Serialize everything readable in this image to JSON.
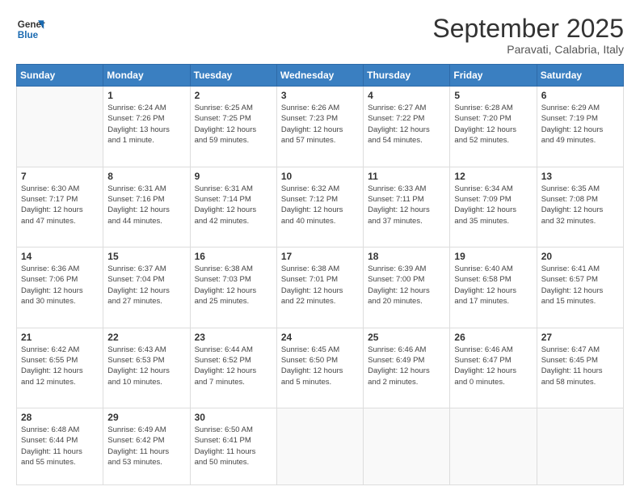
{
  "logo": {
    "text_general": "General",
    "text_blue": "Blue"
  },
  "title": "September 2025",
  "subtitle": "Paravati, Calabria, Italy",
  "header_days": [
    "Sunday",
    "Monday",
    "Tuesday",
    "Wednesday",
    "Thursday",
    "Friday",
    "Saturday"
  ],
  "weeks": [
    [
      {
        "day": "",
        "info": ""
      },
      {
        "day": "1",
        "info": "Sunrise: 6:24 AM\nSunset: 7:26 PM\nDaylight: 13 hours\nand 1 minute."
      },
      {
        "day": "2",
        "info": "Sunrise: 6:25 AM\nSunset: 7:25 PM\nDaylight: 12 hours\nand 59 minutes."
      },
      {
        "day": "3",
        "info": "Sunrise: 6:26 AM\nSunset: 7:23 PM\nDaylight: 12 hours\nand 57 minutes."
      },
      {
        "day": "4",
        "info": "Sunrise: 6:27 AM\nSunset: 7:22 PM\nDaylight: 12 hours\nand 54 minutes."
      },
      {
        "day": "5",
        "info": "Sunrise: 6:28 AM\nSunset: 7:20 PM\nDaylight: 12 hours\nand 52 minutes."
      },
      {
        "day": "6",
        "info": "Sunrise: 6:29 AM\nSunset: 7:19 PM\nDaylight: 12 hours\nand 49 minutes."
      }
    ],
    [
      {
        "day": "7",
        "info": "Sunrise: 6:30 AM\nSunset: 7:17 PM\nDaylight: 12 hours\nand 47 minutes."
      },
      {
        "day": "8",
        "info": "Sunrise: 6:31 AM\nSunset: 7:16 PM\nDaylight: 12 hours\nand 44 minutes."
      },
      {
        "day": "9",
        "info": "Sunrise: 6:31 AM\nSunset: 7:14 PM\nDaylight: 12 hours\nand 42 minutes."
      },
      {
        "day": "10",
        "info": "Sunrise: 6:32 AM\nSunset: 7:12 PM\nDaylight: 12 hours\nand 40 minutes."
      },
      {
        "day": "11",
        "info": "Sunrise: 6:33 AM\nSunset: 7:11 PM\nDaylight: 12 hours\nand 37 minutes."
      },
      {
        "day": "12",
        "info": "Sunrise: 6:34 AM\nSunset: 7:09 PM\nDaylight: 12 hours\nand 35 minutes."
      },
      {
        "day": "13",
        "info": "Sunrise: 6:35 AM\nSunset: 7:08 PM\nDaylight: 12 hours\nand 32 minutes."
      }
    ],
    [
      {
        "day": "14",
        "info": "Sunrise: 6:36 AM\nSunset: 7:06 PM\nDaylight: 12 hours\nand 30 minutes."
      },
      {
        "day": "15",
        "info": "Sunrise: 6:37 AM\nSunset: 7:04 PM\nDaylight: 12 hours\nand 27 minutes."
      },
      {
        "day": "16",
        "info": "Sunrise: 6:38 AM\nSunset: 7:03 PM\nDaylight: 12 hours\nand 25 minutes."
      },
      {
        "day": "17",
        "info": "Sunrise: 6:38 AM\nSunset: 7:01 PM\nDaylight: 12 hours\nand 22 minutes."
      },
      {
        "day": "18",
        "info": "Sunrise: 6:39 AM\nSunset: 7:00 PM\nDaylight: 12 hours\nand 20 minutes."
      },
      {
        "day": "19",
        "info": "Sunrise: 6:40 AM\nSunset: 6:58 PM\nDaylight: 12 hours\nand 17 minutes."
      },
      {
        "day": "20",
        "info": "Sunrise: 6:41 AM\nSunset: 6:57 PM\nDaylight: 12 hours\nand 15 minutes."
      }
    ],
    [
      {
        "day": "21",
        "info": "Sunrise: 6:42 AM\nSunset: 6:55 PM\nDaylight: 12 hours\nand 12 minutes."
      },
      {
        "day": "22",
        "info": "Sunrise: 6:43 AM\nSunset: 6:53 PM\nDaylight: 12 hours\nand 10 minutes."
      },
      {
        "day": "23",
        "info": "Sunrise: 6:44 AM\nSunset: 6:52 PM\nDaylight: 12 hours\nand 7 minutes."
      },
      {
        "day": "24",
        "info": "Sunrise: 6:45 AM\nSunset: 6:50 PM\nDaylight: 12 hours\nand 5 minutes."
      },
      {
        "day": "25",
        "info": "Sunrise: 6:46 AM\nSunset: 6:49 PM\nDaylight: 12 hours\nand 2 minutes."
      },
      {
        "day": "26",
        "info": "Sunrise: 6:46 AM\nSunset: 6:47 PM\nDaylight: 12 hours\nand 0 minutes."
      },
      {
        "day": "27",
        "info": "Sunrise: 6:47 AM\nSunset: 6:45 PM\nDaylight: 11 hours\nand 58 minutes."
      }
    ],
    [
      {
        "day": "28",
        "info": "Sunrise: 6:48 AM\nSunset: 6:44 PM\nDaylight: 11 hours\nand 55 minutes."
      },
      {
        "day": "29",
        "info": "Sunrise: 6:49 AM\nSunset: 6:42 PM\nDaylight: 11 hours\nand 53 minutes."
      },
      {
        "day": "30",
        "info": "Sunrise: 6:50 AM\nSunset: 6:41 PM\nDaylight: 11 hours\nand 50 minutes."
      },
      {
        "day": "",
        "info": ""
      },
      {
        "day": "",
        "info": ""
      },
      {
        "day": "",
        "info": ""
      },
      {
        "day": "",
        "info": ""
      }
    ]
  ]
}
